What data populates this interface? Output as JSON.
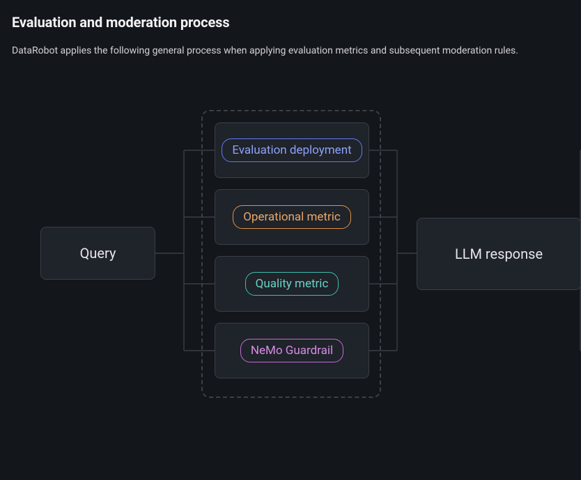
{
  "header": {
    "title": "Evaluation and moderation process",
    "subtitle": "DataRobot applies the following general process when applying evaluation metrics and subsequent moderation rules."
  },
  "diagram": {
    "query_label": "Query",
    "llm_label": "LLM response",
    "middle": {
      "evaluation_deployment": "Evaluation deployment",
      "operational_metric": "Operational metric",
      "quality_metric": "Quality metric",
      "nemo_guardrail": "NeMo Guardrail"
    },
    "pill_colors": {
      "evaluation_deployment": "#5f7af3",
      "operational_metric": "#e39043",
      "quality_metric": "#3cbfb0",
      "nemo_guardrail": "#c66bd8"
    }
  }
}
